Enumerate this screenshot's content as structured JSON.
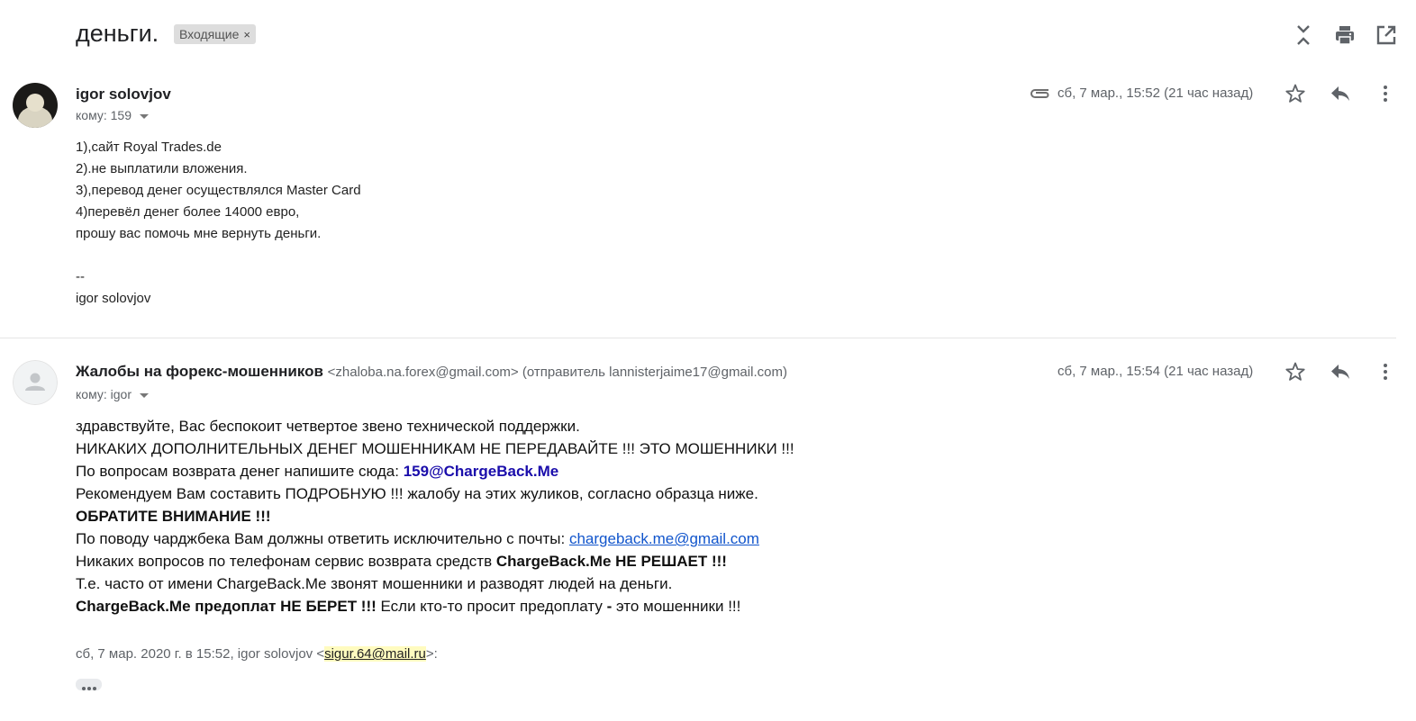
{
  "subject": "деньги.",
  "label": {
    "text": "Входящие",
    "close": "×"
  },
  "icons": [
    "collapse-all-icon",
    "print-icon",
    "open-in-new-window-icon"
  ],
  "messages": [
    {
      "sender": "igor solovjov",
      "to_label": "кому: 159",
      "date": "сб, 7 мар., 15:52 (21 час назад)",
      "has_attachment": true,
      "body": [
        "1),сайт  Royal Trades.de",
        "2).не выплатили вложения.",
        "3),перевод денег осуществлялся Master Card",
        "4)перевёл денег более 14000 евро,",
        "прошу вас помочь мне вернуть деньги.",
        "",
        "--",
        "igor solovjov"
      ]
    },
    {
      "sender": "Жалобы на форекс-мошенников",
      "sender_email": "<zhaloba.na.forex@gmail.com> (отправитель lannisterjaime17@gmail.com)",
      "to_label": "кому: igor",
      "date": "сб, 7 мар., 15:54 (21 час назад)",
      "body": {
        "l1": "здравствуйте, Вас беспокоит четвертое звено технической поддержки.",
        "l2": "НИКАКИХ ДОПОЛНИТЕЛЬНЫХ ДЕНЕГ МОШЕННИКАМ НЕ ПЕРЕДАВАЙТЕ !!! ЭТО МОШЕННИКИ !!!",
        "l3_prefix": "По вопросам возврата денег напишите сюда: ",
        "l3_link": "159@ChargeBack.Me",
        "l4": "Рекомендуем Вам составить ПОДРОБНУЮ !!! жалобу на этих жуликов, согласно образца ниже.",
        "l5": "ОБРАТИТЕ ВНИМАНИЕ !!!",
        "l6_prefix": "По поводу чарджбека Вам должны ответить исключительно с почты: ",
        "l6_link": "chargeback.me@gmail.com",
        "l7_prefix": "Никаких вопросов по телефонам сервис возврата средств ",
        "l7_bold": "ChargeBack.Me НЕ РЕШАЕТ !!!",
        "l8": "Т.е. часто от имени ChargeBack.Me звонят мошенники и разводят людей на деньги.",
        "l9_bold": "ChargeBack.Me предоплат НЕ БЕРЕТ !!!",
        "l9_mid": " Если кто-то просит предоплату ",
        "l9_dash": "-",
        "l9_suffix": " это мошенники !!!"
      },
      "quote_prefix": "сб, 7 мар. 2020 г. в 15:52, igor solovjov <",
      "quote_email": "sigur.64@mail.ru",
      "quote_suffix": ">:"
    }
  ],
  "colors": {
    "link_blue": "#1a0dab",
    "link": "#1155cc",
    "highlight": "#fffbbf"
  }
}
